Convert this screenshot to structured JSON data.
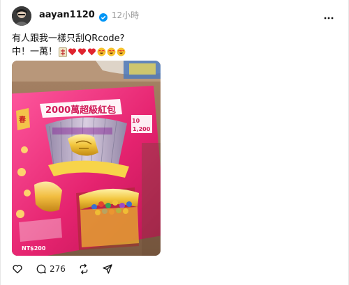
{
  "post": {
    "username": "aayan1120",
    "time": "12小時",
    "caption_line1": "有人跟我一樣只刮QRcode?",
    "caption_line2": "中！一萬！",
    "caption_emojis": [
      "mahjong",
      "heart",
      "heart",
      "heart-eyes",
      "heart-eyes",
      "heart-eyes"
    ],
    "replies_count": "276",
    "image": {
      "ticket_title": "2000萬超級紅包",
      "top_right_number": "10",
      "top_right_amount": "1,200",
      "side_badge": "春",
      "price": "NT$200"
    }
  },
  "icons": [
    "verified-icon",
    "more-icon",
    "like-icon",
    "reply-icon",
    "repost-icon",
    "share-icon"
  ],
  "colors": {
    "verified": "#0095f6",
    "muted": "#9a9a9a",
    "heart": "#e0242f",
    "emoji": "#f7c22e"
  }
}
